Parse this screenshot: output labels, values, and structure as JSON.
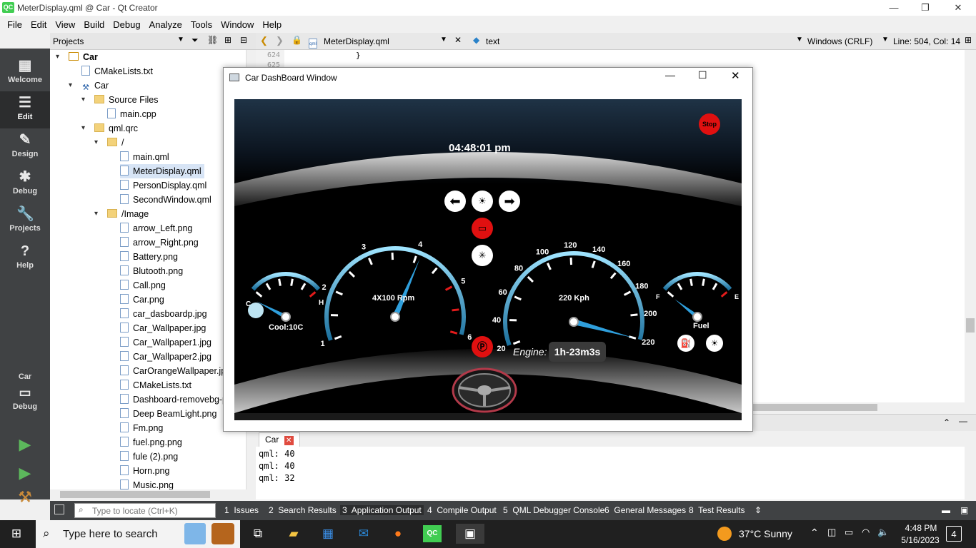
{
  "titlebar": {
    "icon": "QC",
    "title": "MeterDisplay.qml @ Car - Qt Creator",
    "min": "—",
    "max": "❐",
    "close": "✕"
  },
  "menu": [
    "File",
    "Edit",
    "View",
    "Build",
    "Debug",
    "Analyze",
    "Tools",
    "Window",
    "Help"
  ],
  "modes": [
    {
      "label": "Welcome",
      "icon": "grid-icon",
      "glyph": "▦"
    },
    {
      "label": "Edit",
      "icon": "edit-icon",
      "glyph": "☰"
    },
    {
      "label": "Design",
      "icon": "pencil-icon",
      "glyph": "✎"
    },
    {
      "label": "Debug",
      "icon": "bug-icon",
      "glyph": "✱"
    },
    {
      "label": "Projects",
      "icon": "wrench-icon",
      "glyph": "🔧"
    },
    {
      "label": "Help",
      "icon": "help-icon",
      "glyph": "?"
    }
  ],
  "kit": {
    "name": "Car",
    "mode": "Debug"
  },
  "projects": {
    "header": "Projects",
    "tree": [
      {
        "label": "Car",
        "level": 0,
        "kind": "project",
        "bold": true
      },
      {
        "label": "CMakeLists.txt",
        "level": 1,
        "kind": "file"
      },
      {
        "label": "Car",
        "level": 1,
        "kind": "target"
      },
      {
        "label": "Source Files",
        "level": 2,
        "kind": "folder"
      },
      {
        "label": "main.cpp",
        "level": 3,
        "kind": "file"
      },
      {
        "label": "qml.qrc",
        "level": 2,
        "kind": "folder"
      },
      {
        "label": "/",
        "level": 3,
        "kind": "folder"
      },
      {
        "label": "main.qml",
        "level": 4,
        "kind": "file"
      },
      {
        "label": "MeterDisplay.qml",
        "level": 4,
        "kind": "file",
        "selected": true
      },
      {
        "label": "PersonDisplay.qml",
        "level": 4,
        "kind": "file"
      },
      {
        "label": "SecondWindow.qml",
        "level": 4,
        "kind": "file"
      },
      {
        "label": "/Image",
        "level": 3,
        "kind": "folder"
      },
      {
        "label": "arrow_Left.png",
        "level": 4,
        "kind": "file"
      },
      {
        "label": "arrow_Right.png",
        "level": 4,
        "kind": "file"
      },
      {
        "label": "Battery.png",
        "level": 4,
        "kind": "file"
      },
      {
        "label": "Blutooth.png",
        "level": 4,
        "kind": "file"
      },
      {
        "label": "Call.png",
        "level": 4,
        "kind": "file"
      },
      {
        "label": "Car.png",
        "level": 4,
        "kind": "file"
      },
      {
        "label": "car_dasboardp.jpg",
        "level": 4,
        "kind": "file"
      },
      {
        "label": "Car_Wallpaper.jpg",
        "level": 4,
        "kind": "file"
      },
      {
        "label": "Car_Wallpaper1.jpg",
        "level": 4,
        "kind": "file"
      },
      {
        "label": "Car_Wallpaper2.jpg",
        "level": 4,
        "kind": "file"
      },
      {
        "label": "CarOrangeWallpaper.jpg",
        "level": 4,
        "kind": "file"
      },
      {
        "label": "CMakeLists.txt",
        "level": 4,
        "kind": "file"
      },
      {
        "label": "Dashboard-removebg-p",
        "level": 4,
        "kind": "file"
      },
      {
        "label": "Deep BeamLight.png",
        "level": 4,
        "kind": "file"
      },
      {
        "label": "Fm.png",
        "level": 4,
        "kind": "file"
      },
      {
        "label": "fuel.png.png",
        "level": 4,
        "kind": "file"
      },
      {
        "label": "fule (2).png",
        "level": 4,
        "kind": "file"
      },
      {
        "label": "Horn.png",
        "level": 4,
        "kind": "file"
      },
      {
        "label": "Music.png",
        "level": 4,
        "kind": "file"
      }
    ]
  },
  "editor": {
    "file": "MeterDisplay.qml",
    "symbol": "text",
    "encoding": "Windows (CRLF)",
    "position": "Line: 504, Col: 14",
    "lines": [
      {
        "num": "624",
        "code": "}"
      },
      {
        "num": "625",
        "code": ""
      }
    ]
  },
  "output": {
    "tab": "Car",
    "lines": [
      "qml: 40",
      "qml: 40",
      "qml: 32"
    ]
  },
  "locator_placeholder": "Type to locate (Ctrl+K)",
  "bottom_tabs": [
    {
      "num": "1",
      "label": "Issues"
    },
    {
      "num": "2",
      "label": "Search Results"
    },
    {
      "num": "3",
      "label": "Application Output",
      "active": true
    },
    {
      "num": "4",
      "label": "Compile Output"
    },
    {
      "num": "5",
      "label": "QML Debugger Console"
    },
    {
      "num": "6",
      "label": "General Messages"
    },
    {
      "num": "8",
      "label": "Test Results"
    }
  ],
  "dashboard": {
    "window_title": "Car DashBoard Window",
    "time": "04:48:01 pm",
    "stop": "Stop",
    "temp_label": "Cool:10C",
    "temp_low": "C",
    "temp_high": "H",
    "rpm_label": "4X100 Rpm",
    "rpm_ticks": [
      "1",
      "2",
      "3",
      "4",
      "5",
      "6"
    ],
    "speed_label": "220 Kph",
    "speed_ticks": [
      "20",
      "40",
      "60",
      "80",
      "100",
      "120",
      "140",
      "160",
      "180",
      "200",
      "220"
    ],
    "speed_value": 220,
    "fuel_label": "Fuel",
    "fuel_low": "F",
    "fuel_high": "E",
    "engine_label": "Engine:",
    "engine_time": "1h-23m3s",
    "colors": {
      "accent": "#29a3d6",
      "warning": "#e31b1b",
      "needle": "#2f9fdc"
    }
  },
  "taskbar": {
    "search_placeholder": "Type here to search",
    "weather": "37°C  Sunny",
    "time": "4:48 PM",
    "date": "5/16/2023",
    "notifications": "4"
  }
}
